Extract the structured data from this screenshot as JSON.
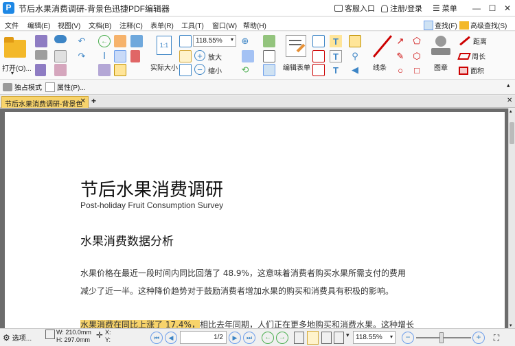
{
  "window": {
    "app_icon": "P",
    "title": "节后水果消费调研-背景色迅捷PDF编辑器",
    "service": "客服入口",
    "login": "注册/登录",
    "menu": "菜单"
  },
  "menubar": [
    "文件",
    "编辑(E)",
    "视图(V)",
    "文档(B)",
    "注释(C)",
    "表单(R)",
    "工具(T)",
    "窗口(W)",
    "帮助(H)"
  ],
  "ribbon": {
    "open": "打开(O)...",
    "actual_size": "实际大小",
    "zoom_value": "118.55%",
    "zoom_in": "放大",
    "zoom_out": "缩小",
    "edit_form": "编辑表单",
    "line": "线条",
    "stamp": "图章",
    "find": "查找(F)",
    "advanced_find": "高级查找(S)",
    "distance": "距离",
    "perimeter": "周长",
    "area": "面积"
  },
  "subbar": {
    "exclusive": "独占模式",
    "properties": "属性(P)..."
  },
  "tabs": {
    "doc_tab": "节后水果消费调研-背景色"
  },
  "document": {
    "title": "节后水果消费调研",
    "subtitle": "Post-holiday Fruit Consumption Survey",
    "heading": "水果消费数据分析",
    "para1_line1": "水果价格在最近一段时间内同比回落了 48.9%，这意味着消费者购买水果所需支付的费用",
    "para1_line2": "减少了近一半。这种降价趋势对于鼓励消费者增加水果的购买和消费具有积极的影响。",
    "para2_highlight": "水果消费在同比上涨了 17.4%，",
    "para2_rest": "相比去年同期，人们正在更多地购买和消费水果。这种增长"
  },
  "statusbar": {
    "select": "选项...",
    "width": "W: 210.0mm",
    "height": "H: 297.0mm",
    "x": "X:",
    "y": "Y:",
    "page": "1",
    "page_total": "/2",
    "zoom": "118.55%"
  }
}
